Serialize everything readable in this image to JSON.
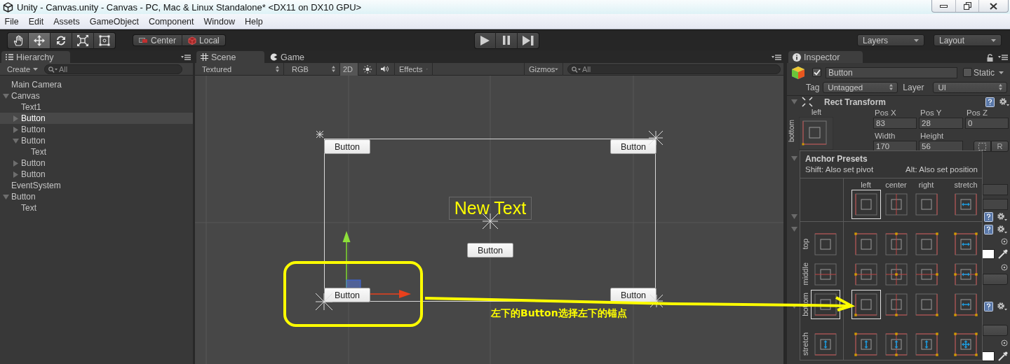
{
  "window": {
    "title": "Unity - Canvas.unity - Canvas - PC, Mac & Linux Standalone* <DX11 on DX10 GPU>"
  },
  "menu": [
    "File",
    "Edit",
    "Assets",
    "GameObject",
    "Component",
    "Window",
    "Help"
  ],
  "toolbar": {
    "tools": [
      {
        "kind": "hand",
        "selected": false
      },
      {
        "kind": "move",
        "selected": true
      },
      {
        "kind": "rotate",
        "selected": false
      },
      {
        "kind": "scale",
        "selected": false
      },
      {
        "kind": "rect",
        "selected": false
      }
    ],
    "pivot": [
      {
        "kind": "center",
        "label": "Center"
      },
      {
        "kind": "local",
        "label": "Local"
      }
    ],
    "layers": "Layers",
    "layout": "Layout"
  },
  "hierarchy": {
    "title": "Hierarchy",
    "create": "Create",
    "search": {
      "placeholder": "All"
    },
    "items": [
      {
        "label": "Main Camera",
        "selected": false
      },
      {
        "label": "Canvas",
        "selected": false,
        "expanded": true,
        "children": [
          {
            "label": "Text1",
            "selected": false
          },
          {
            "label": "Button",
            "selected": true,
            "expanded": false
          },
          {
            "label": "Button",
            "selected": false,
            "expanded": false
          },
          {
            "label": "Button",
            "selected": false,
            "expanded": true,
            "children": [
              {
                "label": "Text",
                "selected": false
              }
            ]
          },
          {
            "label": "Button",
            "selected": false,
            "expanded": false
          },
          {
            "label": "Button",
            "selected": false,
            "expanded": false
          }
        ]
      },
      {
        "label": "EventSystem",
        "selected": false
      },
      {
        "label": "Button",
        "selected": false,
        "expanded": true,
        "children": [
          {
            "label": "Text",
            "selected": false
          }
        ]
      }
    ]
  },
  "scene": {
    "tabs": [
      {
        "kind": "scene",
        "label": "Scene",
        "selected": true
      },
      {
        "kind": "game",
        "label": "Game",
        "selected": false
      }
    ],
    "toolbar": {
      "shading": "Textured",
      "color_mode": "RGB",
      "mode_2d": {
        "label": "2D",
        "on": true
      },
      "effects": "Effects",
      "gizmos": "Gizmos",
      "search": {
        "placeholder": "All"
      }
    },
    "canvas": {
      "buttons": [
        "Button",
        "Button",
        "Button",
        "Button",
        "Button"
      ],
      "text": "New Text"
    },
    "annotation": "左下的Button选择左下的锚点"
  },
  "inspector": {
    "title": "Inspector",
    "object": {
      "active": true,
      "name": "Button",
      "static": false,
      "static_label": "Static"
    },
    "tag_label": "Tag",
    "tag": "Untagged",
    "layer_label": "Layer",
    "layer": "UI",
    "rect_transform": {
      "title": "Rect Transform",
      "anchor_h": "left",
      "anchor_v": "bottom",
      "fields": [
        {
          "label": "Pos X",
          "value": "83"
        },
        {
          "label": "Pos Y",
          "value": "28"
        },
        {
          "label": "Pos Z",
          "value": "0"
        },
        {
          "label": "Width",
          "value": "170"
        },
        {
          "label": "Height",
          "value": "56"
        }
      ],
      "raw_button": "R"
    }
  },
  "anchor_presets": {
    "title": "Anchor Presets",
    "shift_hint": "Shift: Also set pivot",
    "alt_hint": "Alt: Also set position",
    "columns": [
      "left",
      "center",
      "right",
      "stretch"
    ],
    "rows": [
      "top",
      "middle",
      "bottom",
      "stretch"
    ],
    "top_row": [
      {
        "selected": true
      },
      {
        "selected": false
      },
      {
        "selected": false
      },
      {
        "selected": false
      }
    ],
    "left_column": [
      {
        "selected": false
      },
      {
        "selected": false
      },
      {
        "selected": true
      },
      {
        "selected": false
      }
    ],
    "grid": [
      [
        {
          "selected": false
        },
        {
          "selected": false
        },
        {
          "selected": false
        },
        {
          "selected": false
        }
      ],
      [
        {
          "selected": false
        },
        {
          "selected": false
        },
        {
          "selected": false
        },
        {
          "selected": false
        }
      ],
      [
        {
          "selected": true
        },
        {
          "selected": false
        },
        {
          "selected": false
        },
        {
          "selected": false
        }
      ],
      [
        {
          "selected": false
        },
        {
          "selected": false
        },
        {
          "selected": false
        },
        {
          "selected": false
        }
      ]
    ]
  }
}
